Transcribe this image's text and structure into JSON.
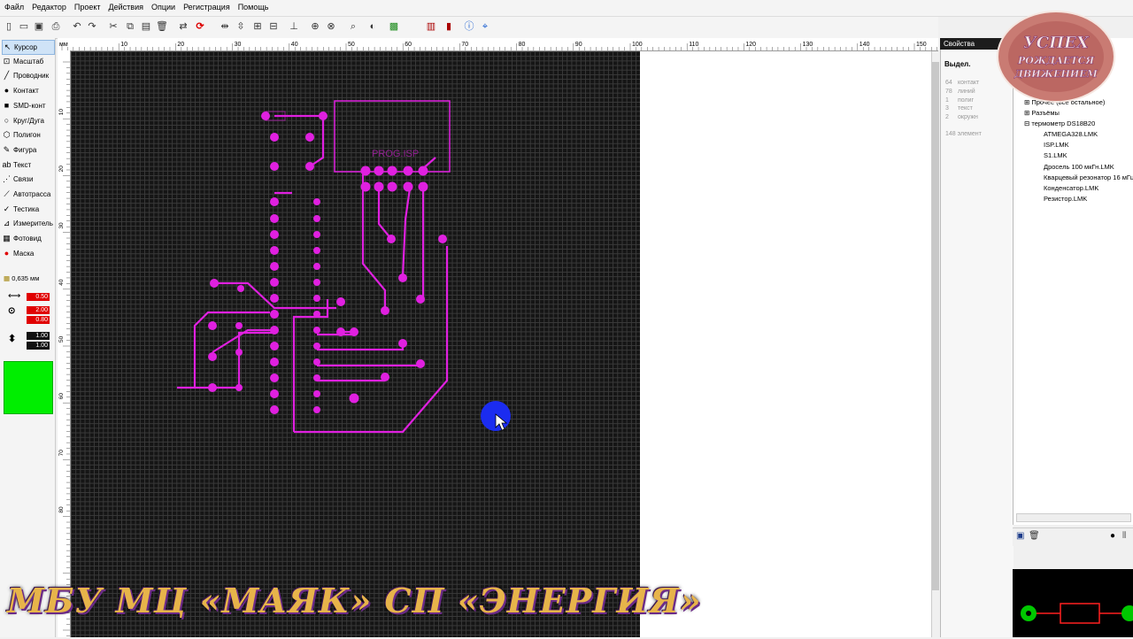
{
  "menu": [
    "Файл",
    "Редактор",
    "Проект",
    "Действия",
    "Опции",
    "Регистрация",
    "Помощь"
  ],
  "tools": [
    {
      "label": "Курсор",
      "icon": "cursor-icon",
      "glyph": "↖",
      "selected": true
    },
    {
      "label": "Масштаб",
      "icon": "zoom-icon",
      "glyph": "⊡"
    },
    {
      "label": "Проводник",
      "icon": "wire-icon",
      "glyph": "╱"
    },
    {
      "label": "Контакт",
      "icon": "pad-icon",
      "glyph": "●"
    },
    {
      "label": "SMD-конт",
      "icon": "smd-icon",
      "glyph": "■"
    },
    {
      "label": "Круг/Дуга",
      "icon": "circle-icon",
      "glyph": "○"
    },
    {
      "label": "Полигон",
      "icon": "polygon-icon",
      "glyph": "⬡"
    },
    {
      "label": "Фигура",
      "icon": "shape-icon",
      "glyph": "✎"
    },
    {
      "label": "Текст",
      "icon": "text-icon",
      "glyph": "ab"
    },
    {
      "label": "Связи",
      "icon": "links-icon",
      "glyph": "⋰"
    },
    {
      "label": "Автотрасса",
      "icon": "autoroute-icon",
      "glyph": "⟋"
    },
    {
      "label": "Тестика",
      "icon": "test-icon",
      "glyph": "✓"
    },
    {
      "label": "Измеритель",
      "icon": "measure-icon",
      "glyph": "⊿"
    },
    {
      "label": "Фотовид",
      "icon": "photo-icon",
      "glyph": "▦"
    },
    {
      "label": "Маска",
      "icon": "mask-icon",
      "glyph": "●"
    }
  ],
  "grid_size": "0,635 мм",
  "params": {
    "v1": "0.50",
    "v2": "2.00",
    "v3": "0.80",
    "v4": "1.00",
    "v5": "1.00"
  },
  "ruler_h": [
    "мм",
    "10",
    "20",
    "30",
    "40",
    "50",
    "60",
    "70",
    "80",
    "90",
    "100",
    "110",
    "120",
    "130",
    "140",
    "150"
  ],
  "ruler_v": [
    "10",
    "20",
    "30",
    "40",
    "50",
    "60",
    "70",
    "80"
  ],
  "props": {
    "title": "Свойства",
    "selected_label": "Выдел.",
    "stats": [
      {
        "n": "64",
        "t": "контакт"
      },
      {
        "n": "78",
        "t": "линий"
      },
      {
        "n": "1",
        "t": "полиг"
      },
      {
        "n": "3",
        "t": "текст"
      },
      {
        "n": "2",
        "t": "окружн"
      }
    ],
    "total": "148 элемент"
  },
  "library": {
    "groups": [
      "Прочее (все остальное)",
      "Разъёмы",
      "термометр DS18B20"
    ],
    "files": [
      "ATMEGA328.LMK",
      "ISP.LMK",
      "S1.LMK",
      "Дросель 100 мкГн.LMK",
      "Кварцевый резонатор 16 мГц",
      "Конденсатор.LMK",
      "Резистор.LMK"
    ]
  },
  "silk_text": "PROG.ISP",
  "logo": {
    "line1": "УСПЕХ",
    "line2": "РОЖДАЕТСЯ",
    "line3": "ДВИЖЕНИЕМ"
  },
  "footer": "МБУ МЦ «МАЯК» СП «ЭНЕРГИЯ»",
  "colors": {
    "trace": "#e020e0",
    "board_bg": "#151515",
    "accent": "#00ee00",
    "value_bg": "#e00000",
    "cursor_dot": "#1b2cf0"
  }
}
